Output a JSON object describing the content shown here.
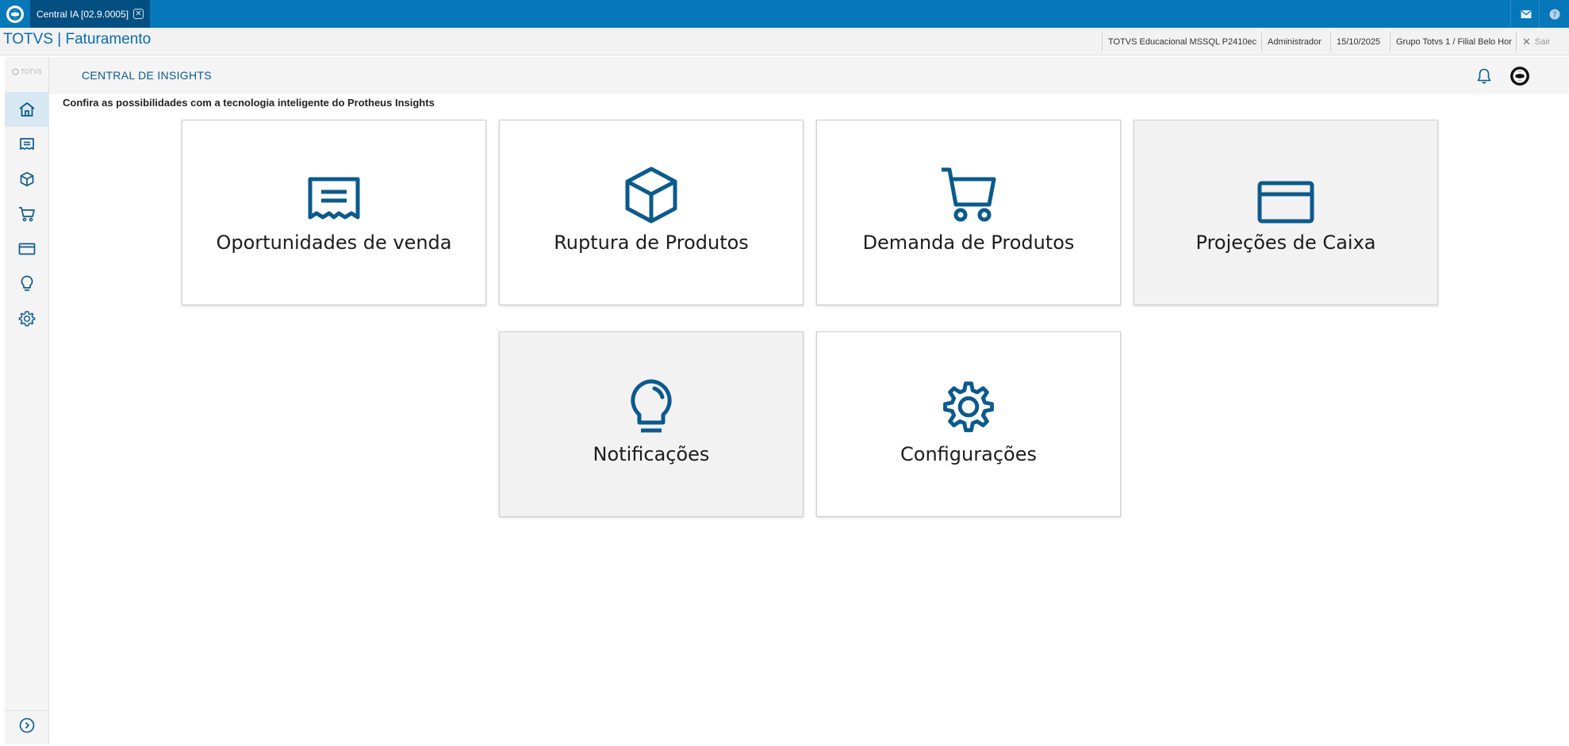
{
  "topbar": {
    "tab_label": "Central IA [02.9.0005]",
    "tab_close": "✕"
  },
  "appbar": {
    "title": "TOTVS | Faturamento",
    "environment": "TOTVS Educacional MSSQL P2410ec",
    "user": "Administrador",
    "date": "15/10/2025",
    "branch": "Grupo Totvs 1 / Filial Belo Hor",
    "logout": "Sair"
  },
  "sidebar": {
    "brand": "TOTVS"
  },
  "page": {
    "title": "CENTRAL DE INSIGHTS",
    "subtitle": "Confira as possibilidades com a tecnologia inteligente do Protheus Insights"
  },
  "cards": [
    {
      "label": "Oportunidades de venda"
    },
    {
      "label": "Ruptura de Produtos"
    },
    {
      "label": "Demanda de Produtos"
    },
    {
      "label": "Projeções de Caixa"
    },
    {
      "label": "Notificações"
    },
    {
      "label": "Configurações"
    }
  ],
  "colors": {
    "topbar": "#0677b8",
    "accent": "#0c5a8c",
    "icon": "#0c5a8c"
  }
}
